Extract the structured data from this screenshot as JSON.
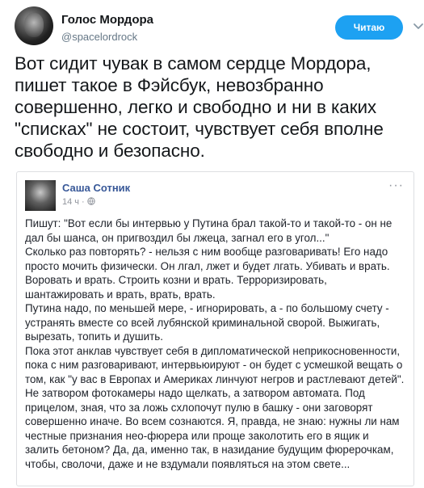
{
  "tweet": {
    "author_name": "Голос Мордора",
    "author_handle": "@spacelordrock",
    "follow_label": "Читаю",
    "text": "Вот сидит чувак в самом сердце Мордора,\nпишет такое в Фэйсбук, невозбранно\nсовершенно, легко и свободно и ни в каких\n\"списках\" не состоит, чувствует себя вполне\nсвободно и безопасно.",
    "icons": {
      "avatar": "user-avatar",
      "menu": "chevron-down-icon"
    },
    "colors": {
      "accent": "#1da1f2",
      "secondary_text": "#657786"
    }
  },
  "fb_post": {
    "author_name": "Саша Сотник",
    "time": "14 ч",
    "dot": "·",
    "more": "···",
    "icons": {
      "privacy": "globe-icon",
      "more": "more-icon"
    },
    "text": "Пишут: \"Вот если бы интервью у Путина брал такой-то и такой-то - он не\nдал бы шанса, он пригвоздил бы лжеца, загнал его в угол...\"\nСколько раз повторять? - нельзя с ним вообще разговаривать! Его надо\nпросто мочить физически. Он лгал, лжет и будет лгать. Убивать и врать.\nВоровать и врать. Строить козни и врать. Терроризировать,\nшантажировать и врать, врать, врать.\nПутина надо, по меньшей мере, - игнорировать, а - по большому счету -\nустранять вместе со всей лубянской криминальной сворой. Выжигать,\nвырезать, топить и душить.\nПока этот анклав чувствует себя в дипломатической неприкосновенности,\nпока с ним разговаривают, интервьюируют - он будет с усмешкой вещать о\nтом, как \"у вас в Европах и Америках линчуют негров и растлевают детей\".\nНе затвором фотокамеры надо щелкать, а затвором автомата. Под\nприцелом, зная, что за ложь схлопочут пулю в башку - они заговорят\nсовершенно иначе. Во всем сознаются. Я, правда, не знаю: нужны ли нам\nчестные признания нео-фюрера или проще заколотить его в ящик и\nзалить бетоном? Да, да, именно так, в назидание будущим фюрерочкам,\nчтобы, сволочи, даже и не вздумали появляться на этом свете...",
    "colors": {
      "name": "#385898",
      "meta": "#90949c"
    }
  }
}
